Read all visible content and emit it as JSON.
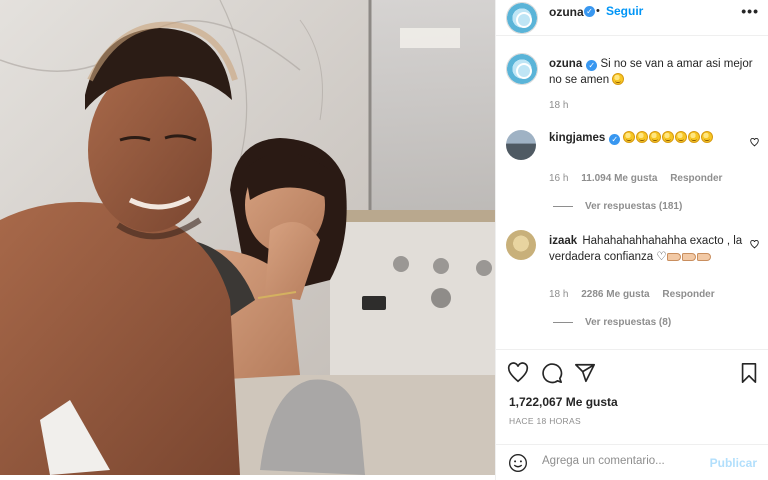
{
  "post": {
    "author": "ozuna",
    "follow_label": "Seguir",
    "separator": "•",
    "more_label": "•••",
    "caption_user": "ozuna",
    "caption_text": "Si no se van a amar asi mejor no se amen",
    "caption_time": "18 h"
  },
  "comments": [
    {
      "user": "kingjames",
      "verified": true,
      "emoji_count": 7,
      "time": "16 h",
      "likes": "11.094 Me gusta",
      "reply": "Responder",
      "view_replies": "Ver respuestas (181)"
    },
    {
      "user": "izaak",
      "verified": false,
      "text": "Hahahahahhahahha exacto , la verdadera confianza",
      "time": "18 h",
      "likes": "2286 Me gusta",
      "reply": "Responder",
      "view_replies": "Ver respuestas (8)"
    }
  ],
  "footer": {
    "likes_count": "1,722,067 Me gusta",
    "time_ago": "HACE 18 HORAS",
    "comment_placeholder": "Agrega un comentario...",
    "publish_label": "Publicar"
  },
  "icons": {
    "like": "heart-icon",
    "comment": "comment-icon",
    "share": "share-icon",
    "save": "bookmark-icon",
    "emoji": "emoji-icon"
  },
  "colors": {
    "accent": "#0095f6",
    "verified": "#3897f0",
    "publish_disabled": "#b2dffc",
    "meta_grey": "#8e8e8e"
  }
}
